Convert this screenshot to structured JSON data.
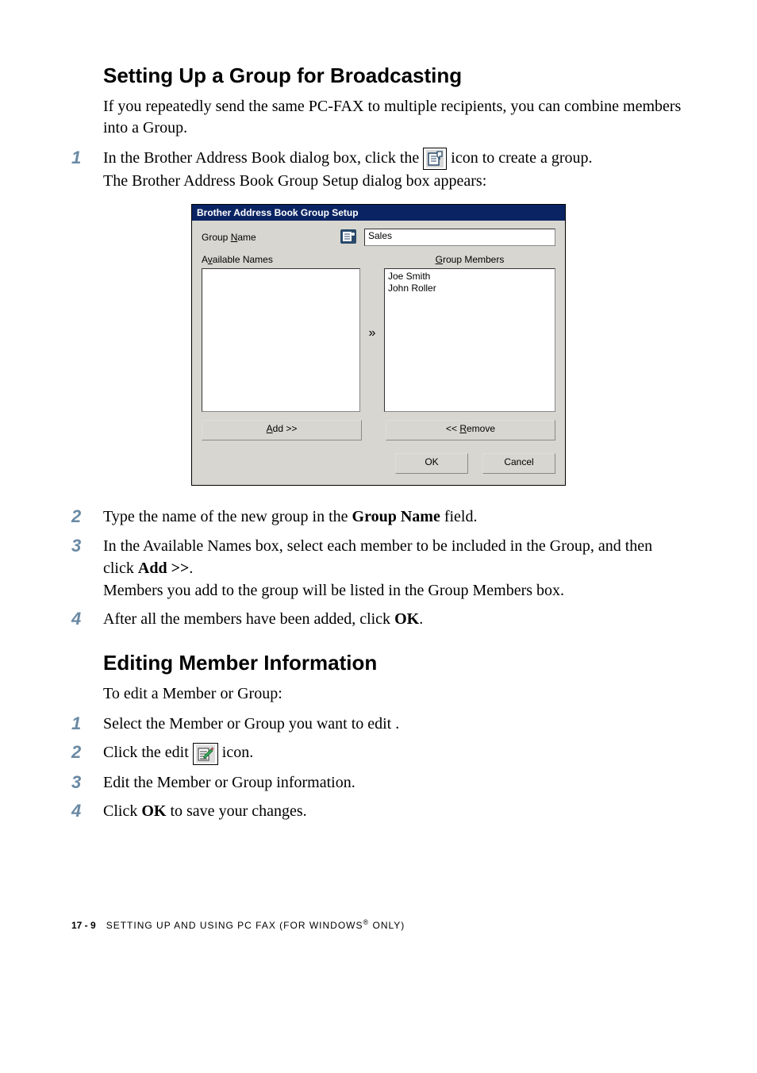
{
  "section1": {
    "heading": "Setting Up a Group for Broadcasting",
    "intro": "If you repeatedly send the same PC-FAX to multiple recipients, you can combine members into a Group.",
    "step1_a": "In the Brother Address Book dialog box, click the ",
    "step1_b": " icon to create a group.",
    "step1_c": "The Brother Address Book Group Setup dialog box appears:",
    "step2_a": "Type the name of the new group in the ",
    "step2_b": "Group Name",
    "step2_c": " field.",
    "step3_a": "In the Available Names box, select each member to be included in the Group, and then click ",
    "step3_b": "Add >>",
    "step3_c": ".",
    "step3_d": "Members you add to the group will be listed in the Group Members box.",
    "step4_a": "After all the members have been added, click ",
    "step4_b": "OK",
    "step4_c": "."
  },
  "nums": {
    "n1": "1",
    "n2": "2",
    "n3": "3",
    "n4": "4"
  },
  "dialog": {
    "title": "Brother Address Book Group Setup",
    "group_name_label_pre": "Group ",
    "group_name_label_u": "N",
    "group_name_label_post": "ame",
    "group_name_value": "Sales",
    "available_pre": "A",
    "available_u": "v",
    "available_post": "ailable Names",
    "members_u": "G",
    "members_post": "roup Members",
    "member1": "Joe Smith",
    "member2": "John Roller",
    "add_u": "A",
    "add_post": "dd >>",
    "remove_pre": "<< ",
    "remove_u": "R",
    "remove_post": "emove",
    "ok": "OK",
    "cancel": "Cancel",
    "arrow": "»"
  },
  "section2": {
    "heading": "Editing Member Information",
    "intro": "To edit a Member or Group:",
    "step1": "Select the Member or Group you want to edit .",
    "step2_a": "Click the edit ",
    "step2_b": " icon.",
    "step3": "Edit the Member or Group information.",
    "step4_a": "Click ",
    "step4_b": "OK",
    "step4_c": " to save your changes."
  },
  "footer": {
    "page": "17 - 9",
    "text_a": "SETTING UP AND USING PC FAX (FOR WINDOWS",
    "text_b": " ONLY)"
  }
}
